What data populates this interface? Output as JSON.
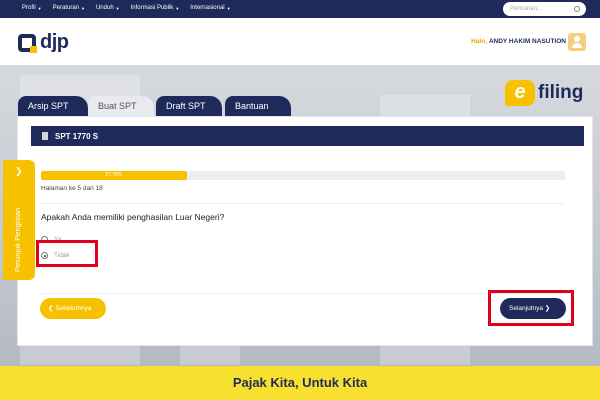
{
  "nav": {
    "items": [
      "Profil",
      "Peraturan",
      "Unduh",
      "Informasi Publik",
      "Internasional"
    ],
    "search_placeholder": "Pencarian..."
  },
  "header": {
    "logo_text": "djp",
    "greeting": "Halo,",
    "user_name": "ANDY HAKIM NASUTION"
  },
  "efiling": {
    "logo_e": "e",
    "logo_text": "filing"
  },
  "tabs": [
    "Arsip SPT",
    "Buat SPT",
    "Draft SPT",
    "Bantuan"
  ],
  "active_tab": "Buat SPT",
  "form": {
    "title": "SPT 1770 S",
    "progress_percent": 27.78,
    "progress_label": "27.78%",
    "page_info": "Halaman ke 5 dari 18",
    "question": "Apakah Anda memiliki penghasilan Luar Negeri?",
    "options": [
      "Ya",
      "Tidak"
    ],
    "selected_option": "Tidak",
    "prev_label": "Sebelumnya",
    "next_label": "Selanjutnya"
  },
  "side_panel": {
    "label": "Petunjuk Pengisian"
  },
  "footer": {
    "tagline": "Pajak Kita, Untuk Kita"
  },
  "colors": {
    "navy": "#1e2b5a",
    "accent": "#f6c200",
    "highlight": "#e0001b"
  }
}
